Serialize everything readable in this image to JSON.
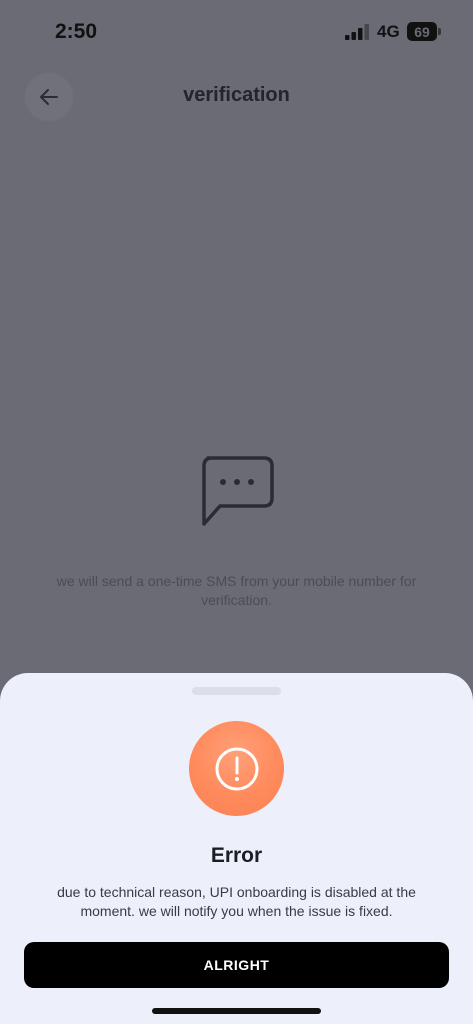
{
  "status_bar": {
    "time": "2:50",
    "network": "4G",
    "battery": "69",
    "icons": {
      "signal": "cellular-signal-icon",
      "battery": "battery-icon"
    }
  },
  "header": {
    "title": "verification",
    "back_icon": "arrow-left-icon"
  },
  "content": {
    "sms_icon": "chat-bubble-dots-icon",
    "note": "we will send a one-time SMS from your mobile number for verification."
  },
  "error_sheet": {
    "icon": "exclamation-circle-icon",
    "title": "Error",
    "message": "due to technical reason, UPI onboarding is disabled at the moment. we will notify you when the issue is fixed.",
    "button_label": "ALRIGHT"
  },
  "colors": {
    "overlay_bg": "#6a6b74",
    "sheet_bg": "#edf0fb",
    "error_orange": "#ff8a5c",
    "button_bg": "#000000"
  }
}
